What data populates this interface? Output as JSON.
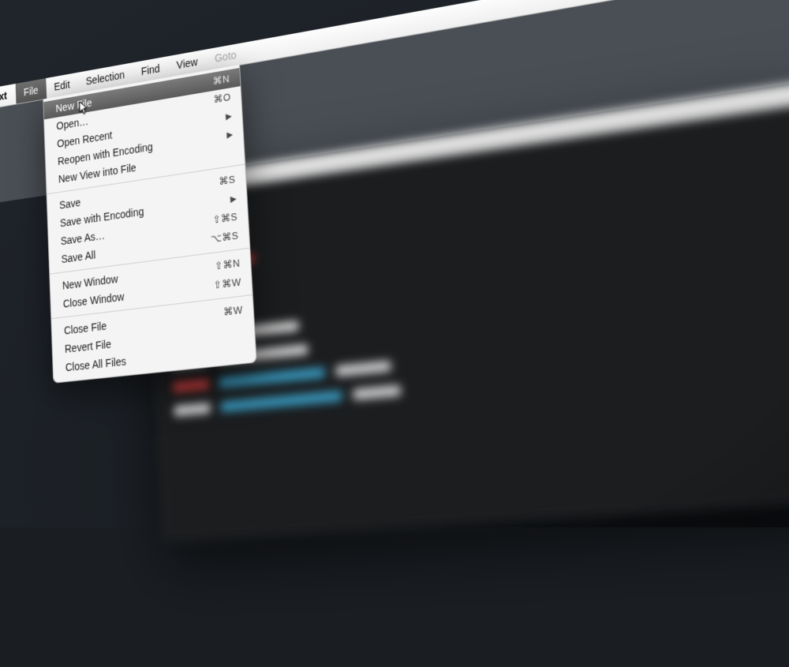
{
  "menubar": {
    "app_name": "Sublime Text",
    "items": [
      {
        "label": "File",
        "open": true
      },
      {
        "label": "Edit",
        "open": false
      },
      {
        "label": "Selection",
        "open": false
      },
      {
        "label": "Find",
        "open": false
      },
      {
        "label": "View",
        "open": false
      },
      {
        "label": "Goto",
        "open": false
      }
    ]
  },
  "file_menu": {
    "groups": [
      [
        {
          "label": "New File",
          "shortcut": "⌘N",
          "submenu": false,
          "highlight": true
        },
        {
          "label": "Open…",
          "shortcut": "⌘O",
          "submenu": false,
          "highlight": false
        },
        {
          "label": "Open Recent",
          "shortcut": "",
          "submenu": true,
          "highlight": false
        },
        {
          "label": "Reopen with Encoding",
          "shortcut": "",
          "submenu": true,
          "highlight": false
        },
        {
          "label": "New View into File",
          "shortcut": "",
          "submenu": false,
          "highlight": false
        }
      ],
      [
        {
          "label": "Save",
          "shortcut": "⌘S",
          "submenu": false,
          "highlight": false
        },
        {
          "label": "Save with Encoding",
          "shortcut": "",
          "submenu": true,
          "highlight": false
        },
        {
          "label": "Save As…",
          "shortcut": "⇧⌘S",
          "submenu": false,
          "highlight": false
        },
        {
          "label": "Save All",
          "shortcut": "⌥⌘S",
          "submenu": false,
          "highlight": false
        }
      ],
      [
        {
          "label": "New Window",
          "shortcut": "⇧⌘N",
          "submenu": false,
          "highlight": false
        },
        {
          "label": "Close Window",
          "shortcut": "⇧⌘W",
          "submenu": false,
          "highlight": false
        }
      ],
      [
        {
          "label": "Close File",
          "shortcut": "⌘W",
          "submenu": false,
          "highlight": false
        },
        {
          "label": "Revert File",
          "shortcut": "",
          "submenu": false,
          "highlight": false
        },
        {
          "label": "Close All Files",
          "shortcut": "",
          "submenu": false,
          "highlight": false
        }
      ]
    ]
  }
}
